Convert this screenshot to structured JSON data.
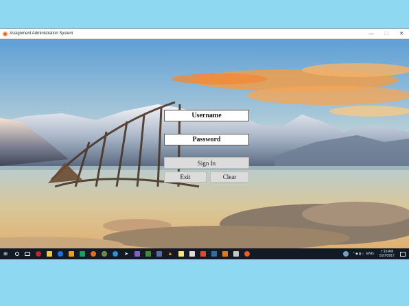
{
  "window": {
    "title": "Assignment Administration System",
    "minimize_glyph": "—",
    "maximize_glyph": "☐",
    "close_glyph": "✕"
  },
  "login": {
    "username_label": "Username",
    "password_label": "Password",
    "sign_in_label": "Sign In",
    "exit_label": "Exit",
    "clear_label": "Clear"
  },
  "taskbar": {
    "icons": [
      "windows-start-icon",
      "search-icon",
      "task-view-icon",
      "game-icon",
      "file-explorer-icon",
      "edge-icon",
      "store-icon",
      "shield-icon",
      "firefox-icon",
      "chrome-icon",
      "edge-icon",
      "visual-studio-icon",
      "vlc-icon",
      "app-icon",
      "notes-icon",
      "app-icon",
      "app-icon",
      "app-icon",
      "app-icon",
      "app-icon",
      "app-icon"
    ],
    "tray_symbols": "^ ◆ ▮ ♪",
    "language": "ENG",
    "time": "7:10 AM",
    "date": "5/27/2017"
  },
  "colors": {
    "sky_top": "#6fa8d8",
    "sky_horizon": "#f6d79a",
    "cloud": "#ee9540",
    "taskbar": "#131a26"
  }
}
